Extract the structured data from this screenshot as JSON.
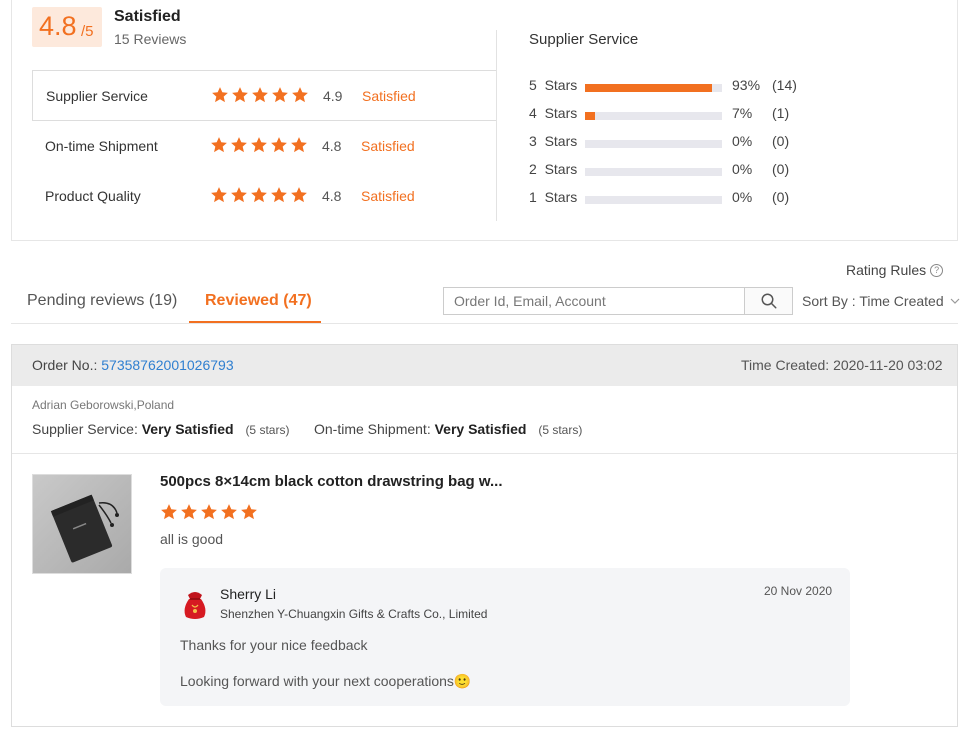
{
  "summary": {
    "score": "4.8",
    "score_suffix": "/5",
    "overall_label": "Satisfied",
    "review_count": "15 Reviews",
    "categories": [
      {
        "name": "Supplier Service",
        "score": "4.9",
        "label": "Satisfied",
        "stars": 5
      },
      {
        "name": "On-time Shipment",
        "score": "4.8",
        "label": "Satisfied",
        "stars": 5
      },
      {
        "name": "Product Quality",
        "score": "4.8",
        "label": "Satisfied",
        "stars": 5
      }
    ],
    "distribution_title": "Supplier Service",
    "distribution": [
      {
        "label": "5  Stars",
        "percent_value": 93,
        "percent": "93%",
        "count": "(14)"
      },
      {
        "label": "4  Stars",
        "percent_value": 7,
        "percent": "7%",
        "count": "(1)"
      },
      {
        "label": "3  Stars",
        "percent_value": 0,
        "percent": "0%",
        "count": "(0)"
      },
      {
        "label": "2  Stars",
        "percent_value": 0,
        "percent": "0%",
        "count": "(0)"
      },
      {
        "label": "1  Stars",
        "percent_value": 0,
        "percent": "0%",
        "count": "(0)"
      }
    ]
  },
  "toolbar": {
    "rating_rules": "Rating Rules",
    "rating_rules_icon": "question-circle-icon",
    "tabs": [
      {
        "label": "Pending reviews (19)",
        "active": false
      },
      {
        "label": "Reviewed (47)",
        "active": true
      }
    ],
    "search_placeholder": "Order Id, Email, Account",
    "search_icon": "search-icon",
    "sort_label": "Sort By : Time Created",
    "sort_icon": "chevron-down-icon"
  },
  "review": {
    "order_label": "Order No.:",
    "order_no": "57358762001026793",
    "time_created": "Time Created: 2020-11-20 03:02",
    "buyer": "Adrian Geborowski,Poland",
    "supplier_service_label": "Supplier Service:",
    "supplier_service_value": "Very Satisfied",
    "supplier_service_stars": "(5 stars)",
    "shipment_label": "On-time Shipment:",
    "shipment_value": "Very Satisfied",
    "shipment_stars": "(5 stars)",
    "product_title": "500pcs 8×14cm black cotton drawstring bag w...",
    "product_stars": 5,
    "review_text": "all is good",
    "reply": {
      "name": "Sherry Li",
      "company": "Shenzhen Y-Chuangxin Gifts & Crafts Co., Limited",
      "date": "20 Nov 2020",
      "line1": "Thanks for your nice feedback",
      "line2": "Looking forward with your next cooperations🙂"
    }
  },
  "colors": {
    "accent": "#f27020",
    "link": "#2f7fd0",
    "track": "#e7e7ed"
  }
}
